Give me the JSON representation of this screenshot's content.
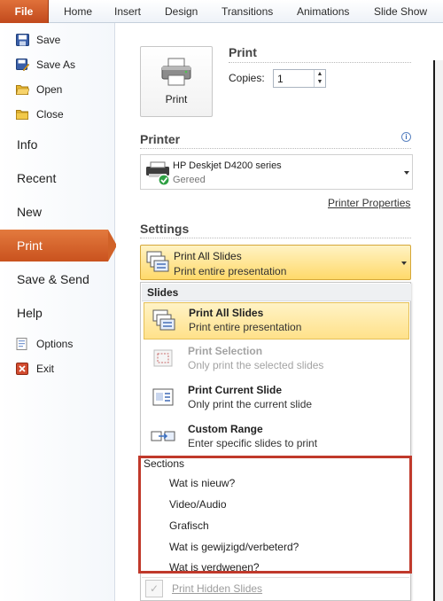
{
  "ribbon": {
    "tabs": [
      {
        "label": "File"
      },
      {
        "label": "Home"
      },
      {
        "label": "Insert"
      },
      {
        "label": "Design"
      },
      {
        "label": "Transitions"
      },
      {
        "label": "Animations"
      },
      {
        "label": "Slide Show"
      }
    ]
  },
  "nav": {
    "commands": [
      {
        "label": "Save",
        "icon": "save-icon"
      },
      {
        "label": "Save As",
        "icon": "save-as-icon"
      },
      {
        "label": "Open",
        "icon": "open-folder-icon"
      },
      {
        "label": "Close",
        "icon": "close-folder-icon"
      }
    ],
    "tabs": [
      {
        "label": "Info"
      },
      {
        "label": "Recent"
      },
      {
        "label": "New"
      },
      {
        "label": "Print"
      },
      {
        "label": "Save & Send"
      },
      {
        "label": "Help"
      }
    ],
    "bottom_commands": [
      {
        "label": "Options",
        "icon": "options-icon"
      },
      {
        "label": "Exit",
        "icon": "exit-icon"
      }
    ],
    "active_tab": "Print",
    "accent": "#d16228"
  },
  "print": {
    "heading": "Print",
    "button_label": "Print",
    "copies_label": "Copies:",
    "copies_value": "1"
  },
  "printer": {
    "heading": "Printer",
    "name": "HP Deskjet D4200 series",
    "status": "Gereed",
    "properties_link": "Printer Properties"
  },
  "settings": {
    "heading": "Settings",
    "selected_title": "Print All Slides",
    "selected_desc": "Print entire presentation",
    "menu": {
      "slides_heading": "Slides",
      "items": [
        {
          "title": "Print All Slides",
          "desc": "Print entire presentation",
          "state": "selected"
        },
        {
          "title": "Print Selection",
          "desc": "Only print the selected slides",
          "state": "disabled"
        },
        {
          "title": "Print Current Slide",
          "desc": "Only print the current slide",
          "state": "normal"
        },
        {
          "title": "Custom Range",
          "desc": "Enter specific slides to print",
          "state": "normal"
        }
      ],
      "sections_heading": "Sections",
      "sections": [
        "Wat is nieuw?",
        "Video/Audio",
        "Grafisch",
        "Wat is gewijzigd/verbeterd?",
        "Wat is verdwenen?"
      ],
      "hidden_slides_label": "Print Hidden Slides",
      "highlight_color": "#c0392b"
    }
  }
}
